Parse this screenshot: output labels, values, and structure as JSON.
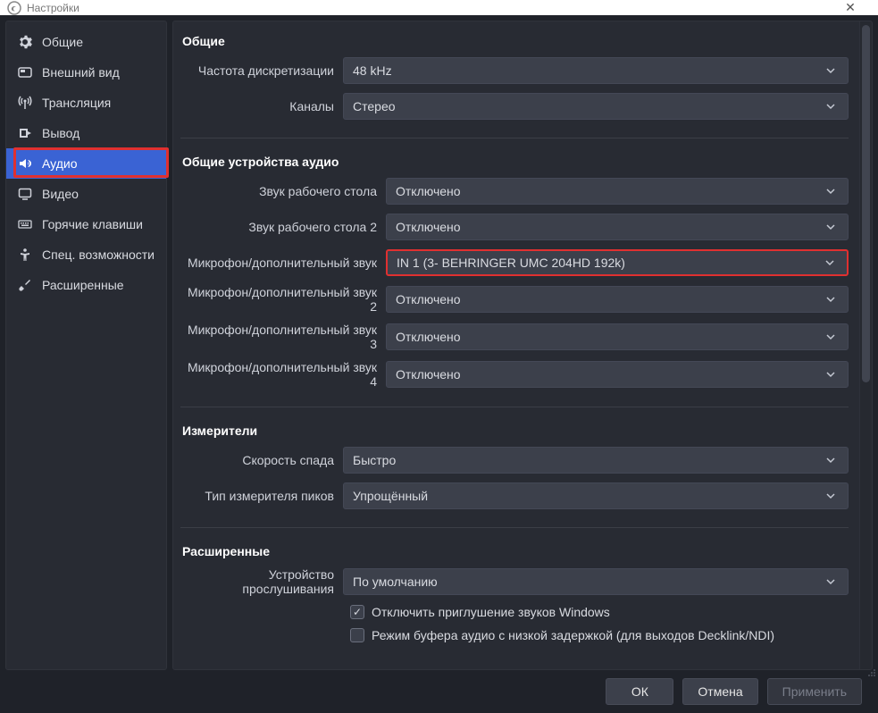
{
  "window_title": "Настройки",
  "sidebar": {
    "items": [
      {
        "label": "Общие",
        "icon": "gear-icon"
      },
      {
        "label": "Внешний вид",
        "icon": "appearance-icon"
      },
      {
        "label": "Трансляция",
        "icon": "antenna-icon"
      },
      {
        "label": "Вывод",
        "icon": "output-icon"
      },
      {
        "label": "Аудио",
        "icon": "speaker-icon"
      },
      {
        "label": "Видео",
        "icon": "monitor-icon"
      },
      {
        "label": "Горячие клавиши",
        "icon": "keyboard-icon"
      },
      {
        "label": "Спец. возможности",
        "icon": "accessibility-icon"
      },
      {
        "label": "Расширенные",
        "icon": "tools-icon"
      }
    ],
    "selected_index": 4
  },
  "sections": {
    "general": {
      "title": "Общие",
      "sample_rate_label": "Частота дискретизации",
      "sample_rate_value": "48 kHz",
      "channels_label": "Каналы",
      "channels_value": "Стерео"
    },
    "devices": {
      "title": "Общие устройства аудио",
      "desktop1_label": "Звук рабочего стола",
      "desktop1_value": "Отключено",
      "desktop2_label": "Звук рабочего стола 2",
      "desktop2_value": "Отключено",
      "mic1_label": "Микрофон/дополнительный звук",
      "mic1_value": "IN 1 (3- BEHRINGER UMC 204HD 192k)",
      "mic2_label": "Микрофон/дополнительный звук 2",
      "mic2_value": "Отключено",
      "mic3_label": "Микрофон/дополнительный звук 3",
      "mic3_value": "Отключено",
      "mic4_label": "Микрофон/дополнительный звук 4",
      "mic4_value": "Отключено"
    },
    "meters": {
      "title": "Измерители",
      "decay_label": "Скорость спада",
      "decay_value": "Быстро",
      "peak_label": "Тип измерителя пиков",
      "peak_value": "Упрощённый"
    },
    "advanced": {
      "title": "Расширенные",
      "monitor_label": "Устройство прослушивания",
      "monitor_value": "По умолчанию",
      "ducking_label": "Отключить приглушение звуков Windows",
      "ducking_checked": true,
      "lowlat_label": "Режим буфера аудио с низкой задержкой (для выходов Decklink/NDI)",
      "lowlat_checked": false
    }
  },
  "buttons": {
    "ok": "ОК",
    "cancel": "Отмена",
    "apply": "Применить"
  }
}
